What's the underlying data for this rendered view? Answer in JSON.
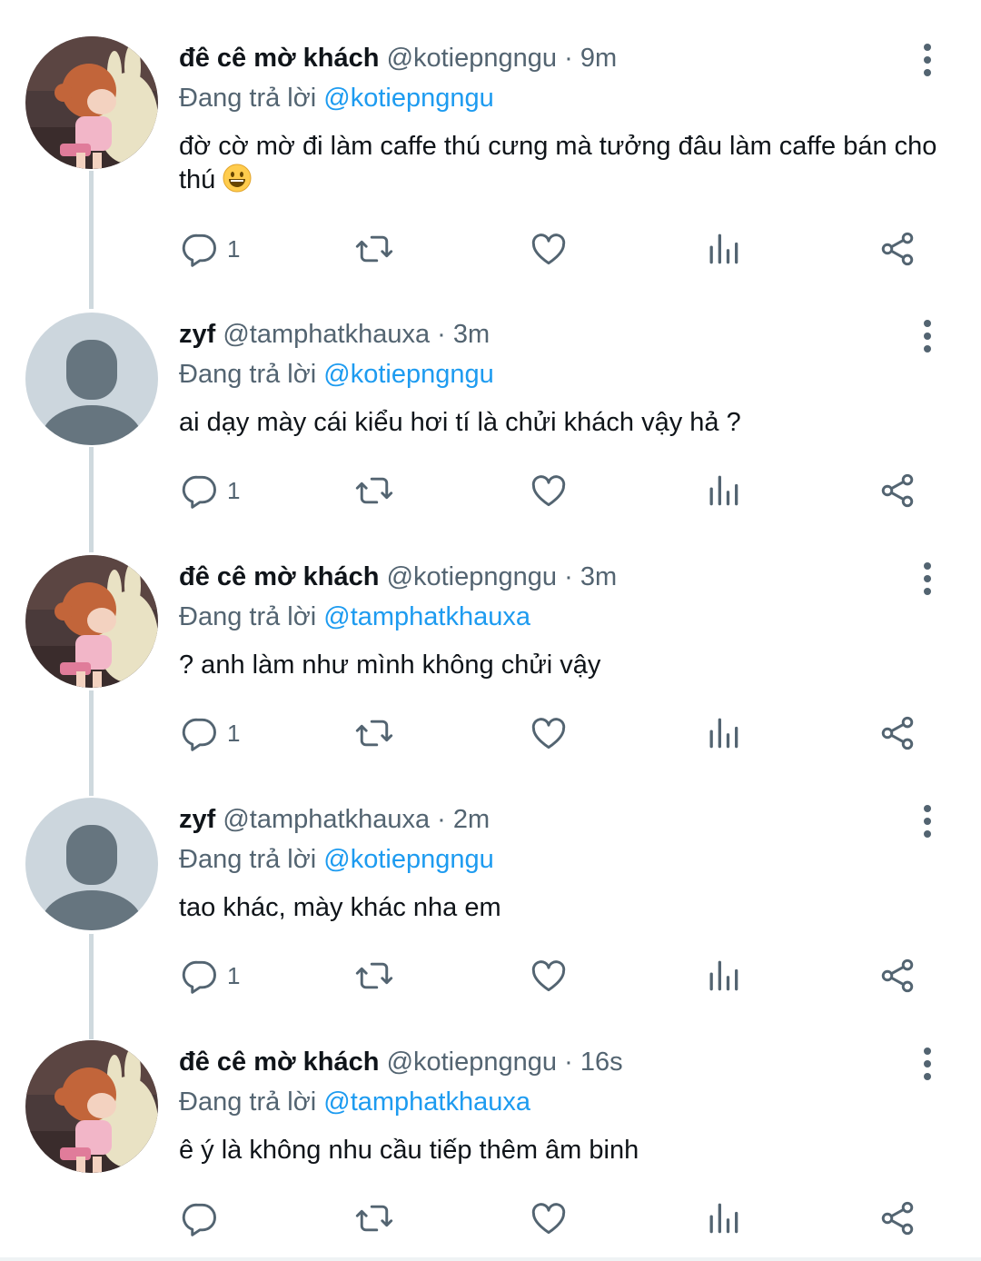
{
  "replying_label": "Đang trả lời",
  "tweets": [
    {
      "name": "đê cê mờ khách",
      "handle": "@kotiepngngu",
      "sep": "·",
      "time": "9m",
      "reply_to": "@kotiepngngu",
      "text": "đờ cờ mờ đi làm caffe thú cưng mà tưởng đâu làm caffe bán cho thú",
      "emoji": "grinning-face-emoji",
      "replies": "1",
      "avatar": "cartoon-girl-avatar"
    },
    {
      "name": "zyf",
      "handle": "@tamphatkhauxa",
      "sep": "·",
      "time": "3m",
      "reply_to": "@kotiepngngu",
      "text": "ai dạy mày cái kiểu hơi tí là chửi khách vậy hả ?",
      "replies": "1",
      "avatar": "default-avatar"
    },
    {
      "name": "đê cê mờ khách",
      "handle": "@kotiepngngu",
      "sep": "·",
      "time": "3m",
      "reply_to": "@tamphatkhauxa",
      "text": "? anh làm như mình không chửi vậy",
      "replies": "1",
      "avatar": "cartoon-girl-avatar"
    },
    {
      "name": "zyf",
      "handle": "@tamphatkhauxa",
      "sep": "·",
      "time": "2m",
      "reply_to": "@kotiepngngu",
      "text": "tao khác, mày khác nha em",
      "replies": "1",
      "avatar": "default-avatar"
    },
    {
      "name": "đê cê mờ khách",
      "handle": "@kotiepngngu",
      "sep": "·",
      "time": "16s",
      "reply_to": "@tamphatkhauxa",
      "text": "ê ý là không nhu cầu tiếp thêm âm binh",
      "replies": "",
      "avatar": "cartoon-girl-avatar"
    }
  ],
  "colors": {
    "text": "#0f1419",
    "secondary": "#536471",
    "link": "#1d9bf0",
    "thread_line": "#cfd9de",
    "default_avatar_bg": "#ccd6dd",
    "default_avatar_fg": "#66757f"
  },
  "icons": [
    "reply-icon",
    "retweet-icon",
    "like-icon",
    "views-icon",
    "share-icon",
    "more-options-icon"
  ]
}
